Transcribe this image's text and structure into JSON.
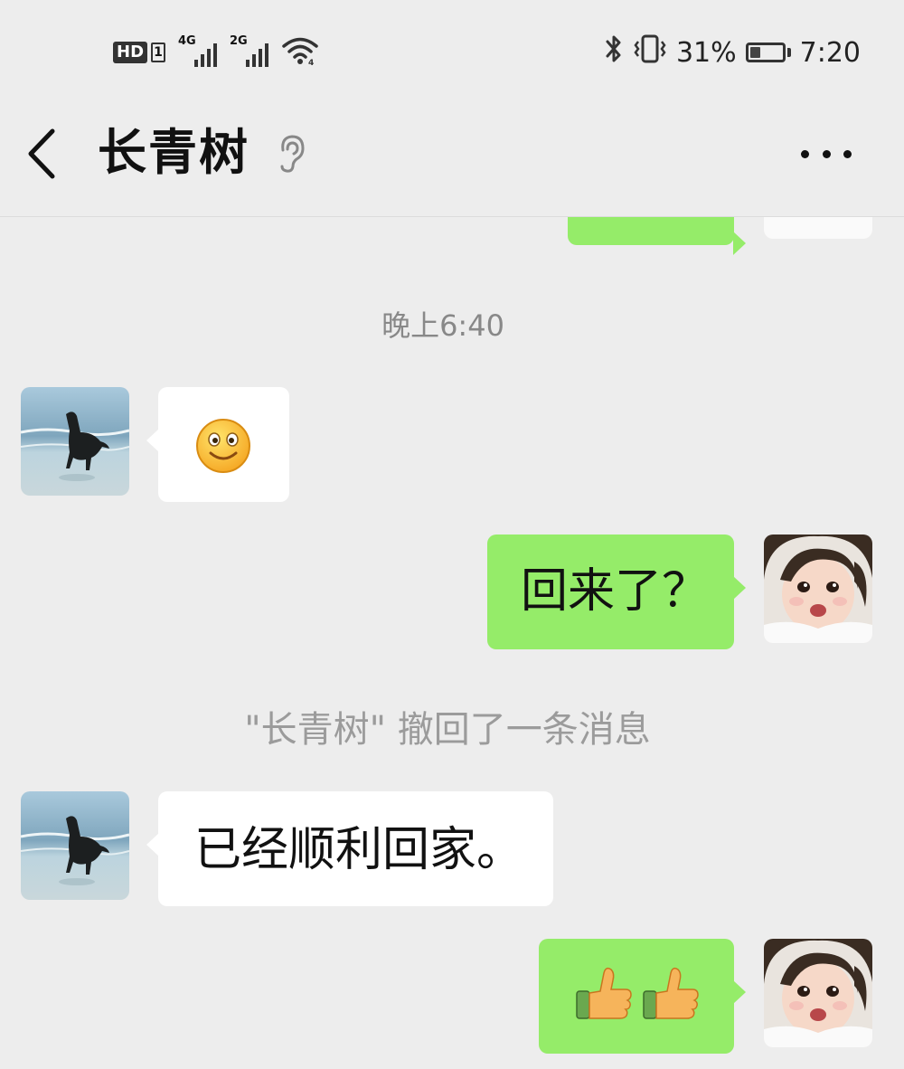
{
  "status_bar": {
    "hd_label": "HD",
    "hd_sim": "1",
    "net1": "4G",
    "net2": "2G",
    "battery_percent": "31%",
    "battery_level": 0.31,
    "time": "7:20",
    "icons": [
      "bluetooth-icon",
      "vibrate-icon",
      "wifi-icon",
      "battery-icon"
    ]
  },
  "header": {
    "title": "长青树",
    "back_icon": "chevron-left-icon",
    "ear_icon": "ear-icon",
    "more_icon": "more-dots-icon"
  },
  "messages": {
    "timestamp": "晚上6:40",
    "items": [
      {
        "side": "out",
        "type": "text",
        "text": ""
      },
      {
        "side": "in",
        "type": "emoji",
        "emoji": "smile-emoji"
      },
      {
        "side": "out",
        "type": "text",
        "text": "回来了？"
      },
      {
        "side": "system",
        "text": "\"长青树\" 撤回了一条消息"
      },
      {
        "side": "in",
        "type": "text",
        "text": "已经顺利回家。"
      },
      {
        "side": "out",
        "type": "emoji",
        "emoji": "thumbs-up-emoji-x2"
      }
    ]
  },
  "colors": {
    "background": "#ededed",
    "outgoing_bubble": "#95ec69",
    "incoming_bubble": "#ffffff",
    "timestamp_text": "#888888"
  }
}
